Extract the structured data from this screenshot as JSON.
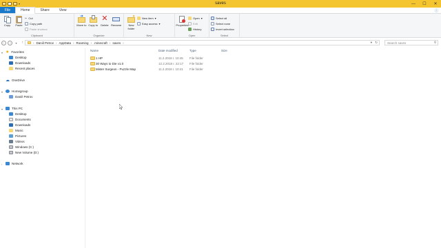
{
  "window": {
    "title": "saves",
    "controls": {
      "minimize": "—",
      "maximize": "☐",
      "close": "✕"
    }
  },
  "tabs": [
    {
      "label": "File"
    },
    {
      "label": "Home"
    },
    {
      "label": "Share"
    },
    {
      "label": "View"
    }
  ],
  "ribbon": {
    "clipboard": {
      "label": "Clipboard",
      "copy": "Copy",
      "paste": "Paste",
      "cut": "Cut",
      "copy_path": "Copy path",
      "paste_shortcut": "Paste shortcut"
    },
    "organize": {
      "label": "Organize",
      "move_to": "Move to",
      "copy_to": "Copy to",
      "delete": "Delete",
      "rename": "Rename"
    },
    "new": {
      "label": "New",
      "new_folder": "New folder",
      "new_item": "New item",
      "easy_access": "Easy access"
    },
    "open": {
      "label": "Open",
      "properties": "Properties",
      "open": "Open",
      "edit": "Edit",
      "history": "History"
    },
    "select": {
      "label": "Select",
      "select_all": "Select all",
      "select_none": "Select none",
      "invert_selection": "Invert selection"
    }
  },
  "address": {
    "path": [
      "Daniil Petrov",
      "AppData",
      "Roaming",
      ".minecraft",
      "saves"
    ],
    "search_placeholder": "Search saves"
  },
  "nav": {
    "favorites": {
      "label": "Favorites",
      "items": [
        "Desktop",
        "Downloads",
        "Recent places"
      ]
    },
    "onedrive": "OneDrive",
    "homegroup": {
      "label": "Homegroup",
      "items": [
        "Daniil Petrov"
      ]
    },
    "this_pc": {
      "label": "This PC",
      "items": [
        "Desktop",
        "Documents",
        "Downloads",
        "Music",
        "Pictures",
        "Videos",
        "Windows (C:)",
        "New Volume (D:)"
      ]
    },
    "network": "Network"
  },
  "columns": [
    "Name",
    "Date modified",
    "Type",
    "Size"
  ],
  "files": [
    {
      "name": "1 HP",
      "date": "11.2.2018 г. 10:45",
      "type": "File folder",
      "size": ""
    },
    {
      "name": "30 Ways to Die v1.0",
      "date": "12.2.2018 г. 22:17",
      "type": "File folder",
      "size": ""
    },
    {
      "name": "Mister Surgeon - Puzzle Map",
      "date": "11.2.2018 г. 10:41",
      "type": "File folder",
      "size": ""
    }
  ],
  "colors": {
    "titlebar": "#f4c431",
    "file_tab": "#1979ca",
    "folder": "#f8d775"
  }
}
